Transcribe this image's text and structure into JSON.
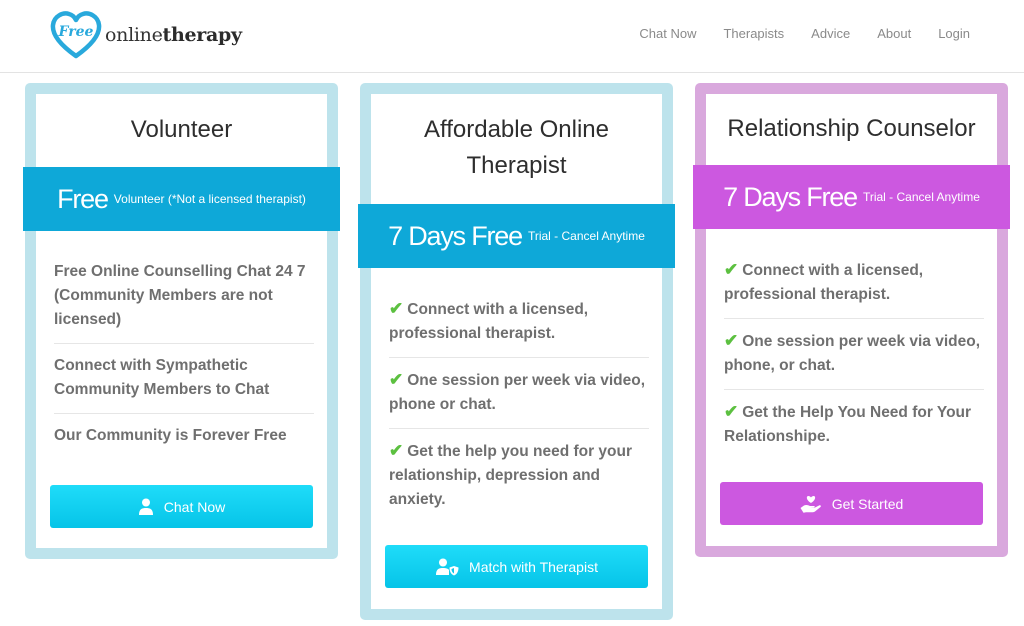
{
  "header": {
    "logo": {
      "badge": "Free",
      "text_light": "online",
      "text_bold": "therapy",
      "color": "#29a9dc"
    },
    "nav": [
      "Chat Now",
      "Therapists",
      "Advice",
      "About",
      "Login"
    ]
  },
  "cards": [
    {
      "title": "Volunteer",
      "ribbon": {
        "big": "Free",
        "small": "Volunteer (*Not a licensed therapist)"
      },
      "features": [
        "Free Online Counselling Chat 24 7 (Community Members are not licensed)",
        "Connect with Sympathetic Community Members to Chat",
        "Our Community is Forever Free"
      ],
      "has_checks": false,
      "button": {
        "label": "Chat Now",
        "icon": "user-icon"
      },
      "accent": "#0ea8d8"
    },
    {
      "title": "Affordable Online Therapist",
      "ribbon": {
        "big": "7 Days Free",
        "small": "Trial - Cancel Anytime"
      },
      "features": [
        "Connect with a licensed, professional therapist.",
        "One session per week via video, phone or chat.",
        "Get the help you need for your relationship, depression and anxiety."
      ],
      "has_checks": true,
      "button": {
        "label": "Match with Therapist",
        "icon": "user-shield-icon"
      },
      "accent": "#0ea8d8"
    },
    {
      "title": "Relationship Counselor",
      "ribbon": {
        "big": "7 Days Free",
        "small": "Trial - Cancel Anytime"
      },
      "features": [
        "Connect with a licensed, professional therapist.",
        "One session per week via video, phone, or chat.",
        "Get the Help You Need for Your Relationshipe."
      ],
      "has_checks": true,
      "button": {
        "label": "Get Started",
        "icon": "hand-holding-heart-icon"
      },
      "accent": "#cc58e0"
    }
  ],
  "check_color": "#5cc040"
}
